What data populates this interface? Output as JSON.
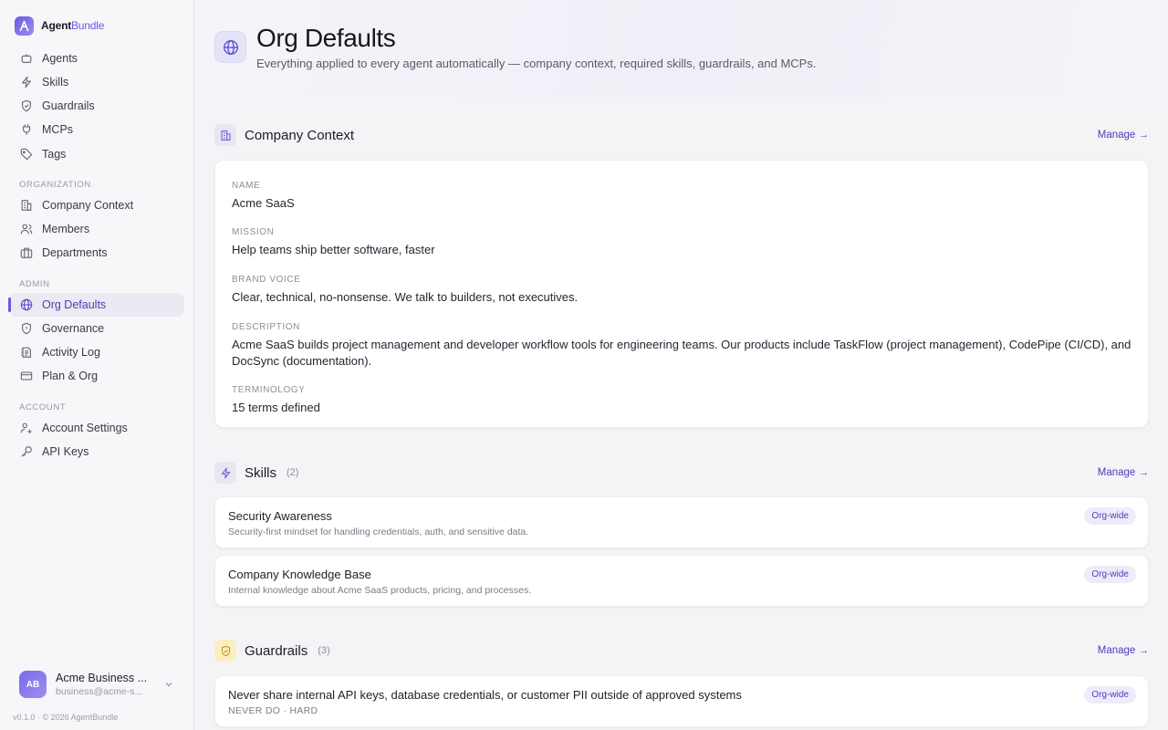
{
  "brand": {
    "name_primary": "Agent",
    "name_accent": "Bundle"
  },
  "nav": {
    "main": [
      {
        "label": "Agents",
        "icon": "bot-icon"
      },
      {
        "label": "Skills",
        "icon": "bolt-icon"
      },
      {
        "label": "Guardrails",
        "icon": "shield-icon"
      },
      {
        "label": "MCPs",
        "icon": "plug-icon"
      },
      {
        "label": "Tags",
        "icon": "tag-icon"
      }
    ],
    "organization_label": "ORGANIZATION",
    "organization": [
      {
        "label": "Company Context",
        "icon": "building-icon"
      },
      {
        "label": "Members",
        "icon": "users-icon"
      },
      {
        "label": "Departments",
        "icon": "briefcase-icon"
      }
    ],
    "admin_label": "ADMIN",
    "admin": [
      {
        "label": "Org Defaults",
        "icon": "globe-icon",
        "active": true
      },
      {
        "label": "Governance",
        "icon": "shield-icon"
      },
      {
        "label": "Activity Log",
        "icon": "log-icon"
      },
      {
        "label": "Plan & Org",
        "icon": "card-icon"
      }
    ],
    "account_label": "ACCOUNT",
    "account": [
      {
        "label": "Account Settings",
        "icon": "user-settings-icon"
      },
      {
        "label": "API Keys",
        "icon": "key-icon"
      }
    ]
  },
  "user": {
    "initials": "AB",
    "name": "Acme Business ...",
    "email": "business@acme-s..."
  },
  "footer": {
    "version": "v0.1.0 · © 2026 AgentBundle"
  },
  "page": {
    "title": "Org Defaults",
    "subtitle": "Everything applied to every agent automatically — company context, required skills, guardrails, and MCPs."
  },
  "company_context": {
    "title": "Company Context",
    "manage": "Manage →",
    "fields": [
      {
        "label": "NAME",
        "value": "Acme SaaS"
      },
      {
        "label": "MISSION",
        "value": "Help teams ship better software, faster"
      },
      {
        "label": "BRAND VOICE",
        "value": "Clear, technical, no-nonsense. We talk to builders, not executives."
      },
      {
        "label": "DESCRIPTION",
        "value": "Acme SaaS builds project management and developer workflow tools for engineering teams. Our products include TaskFlow (project management), CodePipe (CI/CD), and DocSync (documentation)."
      },
      {
        "label": "TERMINOLOGY",
        "value": "15 terms defined"
      }
    ]
  },
  "skills": {
    "title": "Skills",
    "count": "(2)",
    "manage": "Manage →",
    "items": [
      {
        "title": "Security Awareness",
        "desc": "Security-first mindset for handling credentials, auth, and sensitive data.",
        "badge": "Org-wide"
      },
      {
        "title": "Company Knowledge Base",
        "desc": "Internal knowledge about Acme SaaS products, pricing, and processes.",
        "badge": "Org-wide"
      }
    ]
  },
  "guardrails": {
    "title": "Guardrails",
    "count": "(3)",
    "manage": "Manage →",
    "items": [
      {
        "title": "Never share internal API keys, database credentials, or customer PII outside of approved systems",
        "desc": "NEVER DO · HARD",
        "badge": "Org-wide"
      }
    ]
  },
  "colors": {
    "accent": "#6a5ae0",
    "accent_text": "#4a3fb8",
    "badge_bg": "#eeecfa",
    "guardrail_icon_bg": "#fbeec2"
  }
}
